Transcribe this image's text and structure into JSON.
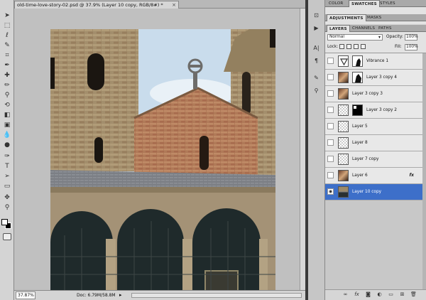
{
  "document": {
    "tab_title": "old-time-love-story-02.psd @ 37.9% (Layer 10 copy, RGB/8#) *",
    "zoom": "37.87%",
    "doc_size": "Doc: 6.79M/58.8M"
  },
  "panels": {
    "top_tabs": [
      "COLOR",
      "SWATCHES",
      "STYLES"
    ],
    "adjust_tabs": [
      "ADJUSTMENTS",
      "MASKS"
    ],
    "layers_tabs": [
      "LAYERS",
      "CHANNELS",
      "PATHS"
    ],
    "blend_mode": "Normal",
    "opacity_label": "Opacity:",
    "opacity_value": "100%",
    "lock_label": "Lock:",
    "fill_label": "Fill:",
    "fill_value": "100%"
  },
  "layers": [
    {
      "name": "Vibrance 1",
      "type": "adjustment",
      "visible": false,
      "selected": false,
      "fx": false
    },
    {
      "name": "Layer 3 copy 4",
      "type": "masked-image",
      "visible": false,
      "selected": false,
      "fx": false
    },
    {
      "name": "Layer 3 copy 3",
      "type": "image",
      "visible": false,
      "selected": false,
      "fx": false
    },
    {
      "name": "Layer 3 copy 2",
      "type": "masked",
      "visible": false,
      "selected": false,
      "fx": false
    },
    {
      "name": "Layer 5",
      "type": "empty",
      "visible": false,
      "selected": false,
      "fx": false
    },
    {
      "name": "Layer 8",
      "type": "empty",
      "visible": false,
      "selected": false,
      "fx": false
    },
    {
      "name": "Layer 7 copy",
      "type": "empty",
      "visible": false,
      "selected": false,
      "fx": false
    },
    {
      "name": "Layer 6",
      "type": "image-small",
      "visible": false,
      "selected": false,
      "fx": true
    },
    {
      "name": "Layer 10 copy",
      "type": "photo",
      "visible": true,
      "selected": true,
      "fx": false
    }
  ],
  "colors": {
    "selection": "#3d6fc9",
    "canvas_bg": "#c0c0c0"
  },
  "icons": {
    "fx": "fx"
  }
}
